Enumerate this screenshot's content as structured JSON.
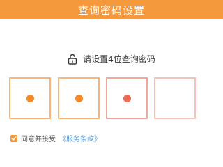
{
  "header": {
    "title": "查询密码设置"
  },
  "prompt": {
    "icon": "unlock-icon",
    "text": "请设置4位查询密码"
  },
  "pin": {
    "length": 4,
    "filled": 3
  },
  "agreement": {
    "checked": true,
    "label": "同意并接受",
    "link_text": "《服务条款》"
  },
  "colors": {
    "header_bg": "#f59a3c",
    "accent": "#f28a2a",
    "link": "#5b9bd5"
  }
}
